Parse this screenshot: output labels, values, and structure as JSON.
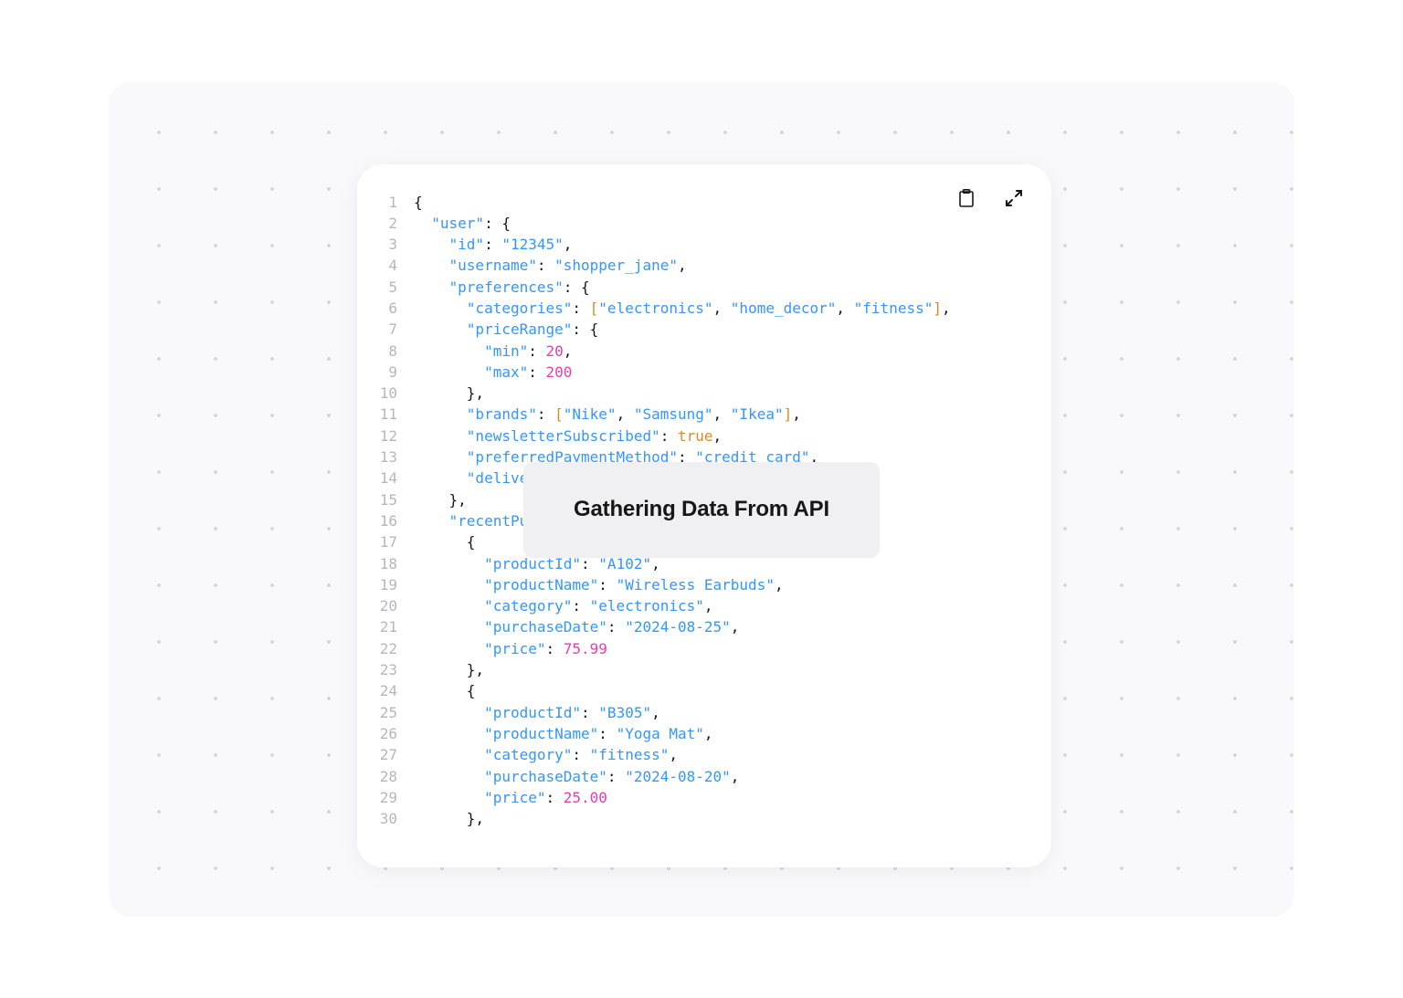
{
  "overlay": {
    "title": "Gathering Data From API"
  },
  "code": {
    "lines": [
      {
        "n": "1",
        "seg": [
          {
            "c": "p",
            "t": "{"
          }
        ]
      },
      {
        "n": "2",
        "seg": [
          {
            "c": "p",
            "t": "  "
          },
          {
            "c": "k",
            "t": "\"user\""
          },
          {
            "c": "p",
            "t": ": {"
          }
        ]
      },
      {
        "n": "3",
        "seg": [
          {
            "c": "p",
            "t": "    "
          },
          {
            "c": "k",
            "t": "\"id\""
          },
          {
            "c": "p",
            "t": ": "
          },
          {
            "c": "k",
            "t": "\"12345\""
          },
          {
            "c": "p",
            "t": ","
          }
        ]
      },
      {
        "n": "4",
        "seg": [
          {
            "c": "p",
            "t": "    "
          },
          {
            "c": "k",
            "t": "\"username\""
          },
          {
            "c": "p",
            "t": ": "
          },
          {
            "c": "k",
            "t": "\"shopper_jane\""
          },
          {
            "c": "p",
            "t": ","
          }
        ]
      },
      {
        "n": "5",
        "seg": [
          {
            "c": "p",
            "t": "    "
          },
          {
            "c": "k",
            "t": "\"preferences\""
          },
          {
            "c": "p",
            "t": ": {"
          }
        ]
      },
      {
        "n": "6",
        "seg": [
          {
            "c": "p",
            "t": "      "
          },
          {
            "c": "k",
            "t": "\"categories\""
          },
          {
            "c": "p",
            "t": ": "
          },
          {
            "c": "b",
            "t": "["
          },
          {
            "c": "k",
            "t": "\"electronics\""
          },
          {
            "c": "p",
            "t": ", "
          },
          {
            "c": "k",
            "t": "\"home_decor\""
          },
          {
            "c": "p",
            "t": ", "
          },
          {
            "c": "k",
            "t": "\"fitness\""
          },
          {
            "c": "b",
            "t": "]"
          },
          {
            "c": "p",
            "t": ","
          }
        ]
      },
      {
        "n": "7",
        "seg": [
          {
            "c": "p",
            "t": "      "
          },
          {
            "c": "k",
            "t": "\"priceRange\""
          },
          {
            "c": "p",
            "t": ": {"
          }
        ]
      },
      {
        "n": "8",
        "seg": [
          {
            "c": "p",
            "t": "        "
          },
          {
            "c": "k",
            "t": "\"min\""
          },
          {
            "c": "p",
            "t": ": "
          },
          {
            "c": "n",
            "t": "20"
          },
          {
            "c": "p",
            "t": ","
          }
        ]
      },
      {
        "n": "9",
        "seg": [
          {
            "c": "p",
            "t": "        "
          },
          {
            "c": "k",
            "t": "\"max\""
          },
          {
            "c": "p",
            "t": ": "
          },
          {
            "c": "n",
            "t": "200"
          }
        ]
      },
      {
        "n": "10",
        "seg": [
          {
            "c": "p",
            "t": "      },"
          }
        ]
      },
      {
        "n": "11",
        "seg": [
          {
            "c": "p",
            "t": "      "
          },
          {
            "c": "k",
            "t": "\"brands\""
          },
          {
            "c": "p",
            "t": ": "
          },
          {
            "c": "b",
            "t": "["
          },
          {
            "c": "k",
            "t": "\"Nike\""
          },
          {
            "c": "p",
            "t": ", "
          },
          {
            "c": "k",
            "t": "\"Samsung\""
          },
          {
            "c": "p",
            "t": ", "
          },
          {
            "c": "k",
            "t": "\"Ikea\""
          },
          {
            "c": "b",
            "t": "]"
          },
          {
            "c": "p",
            "t": ","
          }
        ]
      },
      {
        "n": "12",
        "seg": [
          {
            "c": "p",
            "t": "      "
          },
          {
            "c": "k",
            "t": "\"newsletterSubscribed\""
          },
          {
            "c": "p",
            "t": ": "
          },
          {
            "c": "b",
            "t": "true"
          },
          {
            "c": "p",
            "t": ","
          }
        ]
      },
      {
        "n": "13",
        "seg": [
          {
            "c": "p",
            "t": "      "
          },
          {
            "c": "k",
            "t": "\"preferredPaymentMethod\""
          },
          {
            "c": "p",
            "t": ": "
          },
          {
            "c": "k",
            "t": "\"credit_card\""
          },
          {
            "c": "p",
            "t": ","
          }
        ]
      },
      {
        "n": "14",
        "seg": [
          {
            "c": "p",
            "t": "      "
          },
          {
            "c": "k",
            "t": "\"delive"
          }
        ]
      },
      {
        "n": "15",
        "seg": [
          {
            "c": "p",
            "t": "    },"
          }
        ]
      },
      {
        "n": "16",
        "seg": [
          {
            "c": "p",
            "t": "    "
          },
          {
            "c": "k",
            "t": "\"recentPu"
          }
        ]
      },
      {
        "n": "17",
        "seg": [
          {
            "c": "p",
            "t": "      {"
          }
        ]
      },
      {
        "n": "18",
        "seg": [
          {
            "c": "p",
            "t": "        "
          },
          {
            "c": "k",
            "t": "\"productId\""
          },
          {
            "c": "p",
            "t": ": "
          },
          {
            "c": "k",
            "t": "\"A102\""
          },
          {
            "c": "p",
            "t": ","
          }
        ]
      },
      {
        "n": "19",
        "seg": [
          {
            "c": "p",
            "t": "        "
          },
          {
            "c": "k",
            "t": "\"productName\""
          },
          {
            "c": "p",
            "t": ": "
          },
          {
            "c": "k",
            "t": "\"Wireless Earbuds\""
          },
          {
            "c": "p",
            "t": ","
          }
        ]
      },
      {
        "n": "20",
        "seg": [
          {
            "c": "p",
            "t": "        "
          },
          {
            "c": "k",
            "t": "\"category\""
          },
          {
            "c": "p",
            "t": ": "
          },
          {
            "c": "k",
            "t": "\"electronics\""
          },
          {
            "c": "p",
            "t": ","
          }
        ]
      },
      {
        "n": "21",
        "seg": [
          {
            "c": "p",
            "t": "        "
          },
          {
            "c": "k",
            "t": "\"purchaseDate\""
          },
          {
            "c": "p",
            "t": ": "
          },
          {
            "c": "k",
            "t": "\"2024-08-25\""
          },
          {
            "c": "p",
            "t": ","
          }
        ]
      },
      {
        "n": "22",
        "seg": [
          {
            "c": "p",
            "t": "        "
          },
          {
            "c": "k",
            "t": "\"price\""
          },
          {
            "c": "p",
            "t": ": "
          },
          {
            "c": "n",
            "t": "75.99"
          }
        ]
      },
      {
        "n": "23",
        "seg": [
          {
            "c": "p",
            "t": "      },"
          }
        ]
      },
      {
        "n": "24",
        "seg": [
          {
            "c": "p",
            "t": "      {"
          }
        ]
      },
      {
        "n": "25",
        "seg": [
          {
            "c": "p",
            "t": "        "
          },
          {
            "c": "k",
            "t": "\"productId\""
          },
          {
            "c": "p",
            "t": ": "
          },
          {
            "c": "k",
            "t": "\"B305\""
          },
          {
            "c": "p",
            "t": ","
          }
        ]
      },
      {
        "n": "26",
        "seg": [
          {
            "c": "p",
            "t": "        "
          },
          {
            "c": "k",
            "t": "\"productName\""
          },
          {
            "c": "p",
            "t": ": "
          },
          {
            "c": "k",
            "t": "\"Yoga Mat\""
          },
          {
            "c": "p",
            "t": ","
          }
        ]
      },
      {
        "n": "27",
        "seg": [
          {
            "c": "p",
            "t": "        "
          },
          {
            "c": "k",
            "t": "\"category\""
          },
          {
            "c": "p",
            "t": ": "
          },
          {
            "c": "k",
            "t": "\"fitness\""
          },
          {
            "c": "p",
            "t": ","
          }
        ]
      },
      {
        "n": "28",
        "seg": [
          {
            "c": "p",
            "t": "        "
          },
          {
            "c": "k",
            "t": "\"purchaseDate\""
          },
          {
            "c": "p",
            "t": ": "
          },
          {
            "c": "k",
            "t": "\"2024-08-20\""
          },
          {
            "c": "p",
            "t": ","
          }
        ]
      },
      {
        "n": "29",
        "seg": [
          {
            "c": "p",
            "t": "        "
          },
          {
            "c": "k",
            "t": "\"price\""
          },
          {
            "c": "p",
            "t": ": "
          },
          {
            "c": "n",
            "t": "25.00"
          }
        ]
      },
      {
        "n": "30",
        "seg": [
          {
            "c": "p",
            "t": "      },"
          }
        ]
      }
    ]
  }
}
